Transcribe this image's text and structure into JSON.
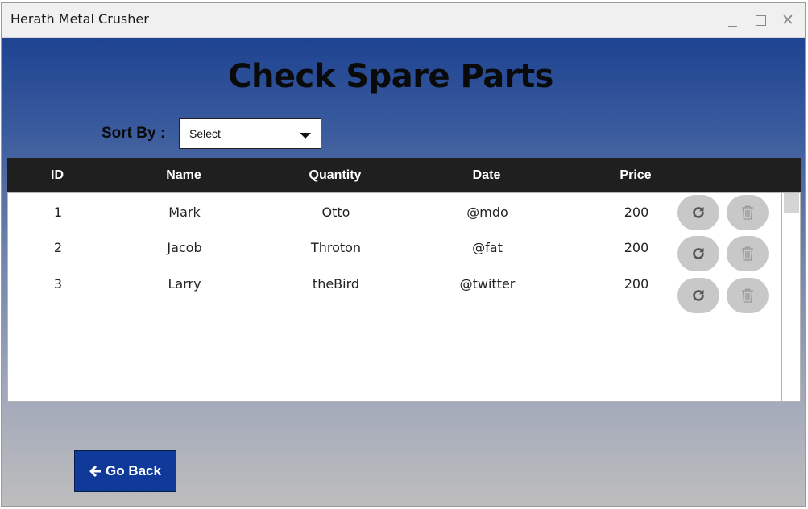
{
  "window": {
    "title": "Herath Metal Crusher",
    "controls": {
      "minimize": "_",
      "maximize": "□",
      "close": "✕"
    }
  },
  "page": {
    "title": "Check Spare Parts"
  },
  "sort": {
    "label": "Sort By :",
    "selected": "Select"
  },
  "table": {
    "headers": [
      "ID",
      "Name",
      "Quantity",
      "Date",
      "Price"
    ],
    "rows": [
      {
        "id": "1",
        "name": "Mark",
        "quantity": "Otto",
        "date": "@mdo",
        "price": "200"
      },
      {
        "id": "2",
        "name": "Jacob",
        "quantity": "Throton",
        "date": "@fat",
        "price": "200"
      },
      {
        "id": "3",
        "name": "Larry",
        "quantity": "theBird",
        "date": "@twitter",
        "price": "200"
      }
    ],
    "row_actions": {
      "update_icon": "refresh-icon",
      "delete_icon": "trash-icon"
    }
  },
  "footer": {
    "back_label": "Go Back",
    "back_icon": "arrow-left-icon"
  },
  "colors": {
    "header_bg": "#1f1f1f",
    "button_bg": "#103a9a",
    "action_button_bg": "#c8c8c8",
    "gradient_top": "#1e4391",
    "gradient_bottom": "#bdbdbd"
  }
}
